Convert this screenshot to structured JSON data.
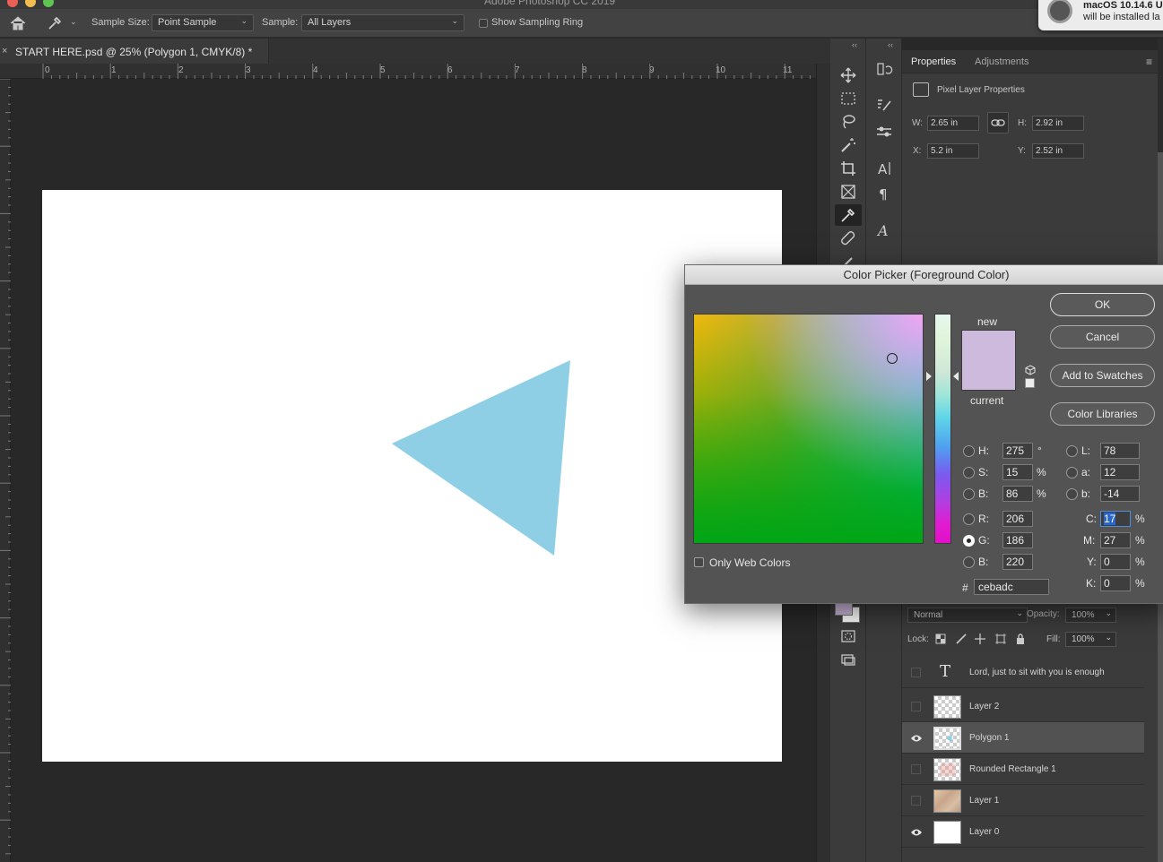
{
  "system": {
    "app_title": "Adobe Photoshop CC 2019",
    "notification_line1": "macOS 10.14.6 U",
    "notification_line2": "will be installed la"
  },
  "options": {
    "sample_size_label": "Sample Size:",
    "sample_size_value": "Point Sample",
    "sample_label": "Sample:",
    "sample_value": "All Layers",
    "show_ring_label": "Show Sampling Ring"
  },
  "document": {
    "close_glyph": "×",
    "tab_title": "START HERE.psd @ 25% (Polygon 1, CMYK/8) *"
  },
  "ruler": {
    "labels": [
      "0",
      "1",
      "2",
      "3",
      "4",
      "5",
      "6",
      "7",
      "8",
      "9",
      "10",
      "11"
    ]
  },
  "canvas": {
    "shape_color": "#8ecfe6"
  },
  "properties": {
    "tab_properties": "Properties",
    "tab_adjustments": "Adjustments",
    "menu_glyph": "≡",
    "section": "Pixel Layer Properties",
    "w_label": "W:",
    "w_value": "2.65 in",
    "h_label": "H:",
    "h_value": "2.92 in",
    "x_label": "X:",
    "x_value": "5.2 in",
    "y_label": "Y:",
    "y_value": "2.52 in"
  },
  "layers": {
    "blend_mode": "Normal",
    "opacity_label": "Opacity:",
    "opacity_value": "100%",
    "lock_label": "Lock:",
    "fill_label": "Fill:",
    "fill_value": "100%",
    "items": [
      {
        "name": "Lord, just to sit  with you  is enough",
        "visible": false,
        "kind": "text"
      },
      {
        "name": "Layer 2",
        "visible": false,
        "kind": "pixel"
      },
      {
        "name": "Polygon 1",
        "visible": true,
        "kind": "pixel",
        "selected": true
      },
      {
        "name": "Rounded Rectangle 1",
        "visible": false,
        "kind": "pixel"
      },
      {
        "name": "Layer 1",
        "visible": false,
        "kind": "pixel"
      },
      {
        "name": "Layer 0",
        "visible": true,
        "kind": "white"
      }
    ]
  },
  "color_picker": {
    "title": "Color Picker (Foreground Color)",
    "new_label": "new",
    "current_label": "current",
    "new_color": "#cebadc",
    "ok": "OK",
    "cancel": "Cancel",
    "add_swatches": "Add to Swatches",
    "color_libraries": "Color Libraries",
    "only_web": "Only Web Colors",
    "hash": "#",
    "hex": "cebadc",
    "deg": "°",
    "pct": "%",
    "hsb": [
      {
        "label": "H:",
        "value": "275",
        "unit": "°"
      },
      {
        "label": "S:",
        "value": "15",
        "unit": "%"
      },
      {
        "label": "B:",
        "value": "86",
        "unit": "%"
      }
    ],
    "rgb": [
      {
        "label": "R:",
        "value": "206"
      },
      {
        "label": "G:",
        "value": "186"
      },
      {
        "label": "B:",
        "value": "220"
      }
    ],
    "lab": [
      {
        "label": "L:",
        "value": "78"
      },
      {
        "label": "a:",
        "value": "12"
      },
      {
        "label": "b:",
        "value": "-14"
      }
    ],
    "cmyk": [
      {
        "label": "C:",
        "value": "17",
        "unit": "%"
      },
      {
        "label": "M:",
        "value": "27",
        "unit": "%"
      },
      {
        "label": "Y:",
        "value": "0",
        "unit": "%"
      },
      {
        "label": "K:",
        "value": "0",
        "unit": "%"
      }
    ]
  }
}
